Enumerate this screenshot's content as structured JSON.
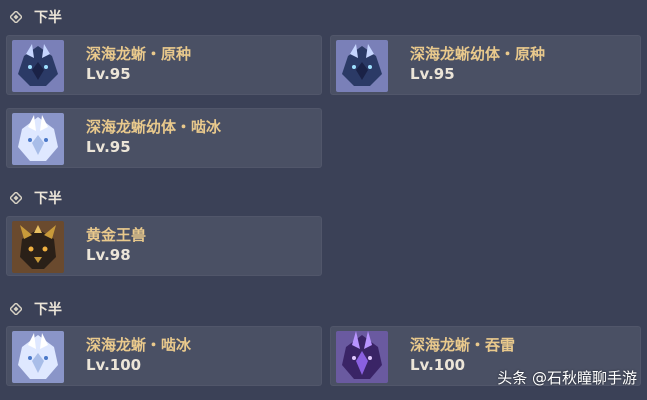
{
  "sections": [
    {
      "title": "下半"
    },
    {
      "title": "下半"
    },
    {
      "title": "下半"
    }
  ],
  "cards": [
    {
      "name": "深海龙蜥・原种",
      "level": "Lv.95",
      "portrait": "vishap-primordial-portrait"
    },
    {
      "name": "深海龙蜥幼体・原种",
      "level": "Lv.95",
      "portrait": "vishap-primordial-portrait"
    },
    {
      "name": "深海龙蜥幼体・啮冰",
      "level": "Lv.95",
      "portrait": "vishap-cryo-portrait"
    },
    {
      "name": "黄金王兽",
      "level": "Lv.98",
      "portrait": "golden-wolflord-portrait"
    },
    {
      "name": "深海龙蜥・啮冰",
      "level": "Lv.100",
      "portrait": "vishap-cryo-portrait"
    },
    {
      "name": "深海龙蜥・吞雷",
      "level": "Lv.100",
      "portrait": "vishap-electro-portrait"
    }
  ],
  "watermark": "头条 @石秋瞳聊手游",
  "colors": {
    "background": "#3b4157",
    "card": "#4a5064",
    "name": "#e9c98c",
    "text": "#ece5d8"
  }
}
